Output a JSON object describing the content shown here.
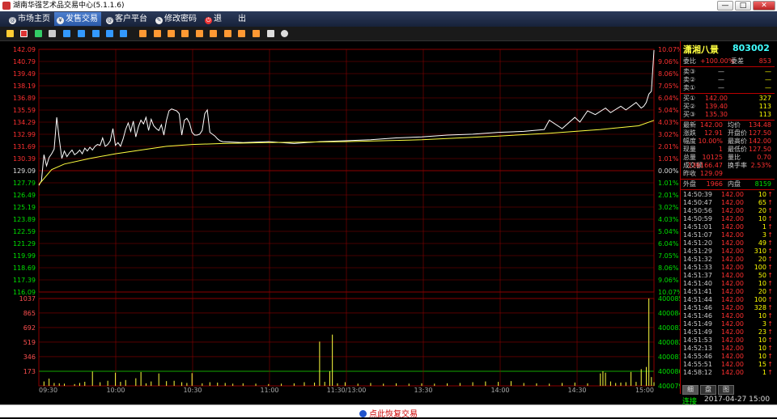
{
  "window": {
    "title": "湖南华强艺术品交易中心(5.1.1.6)",
    "min": "—",
    "max": "□",
    "close": "✕"
  },
  "menu": [
    {
      "label": "市场主页",
      "active": false
    },
    {
      "label": "发售交易",
      "active": true
    },
    {
      "label": "客户平台",
      "active": false
    },
    {
      "label": "修改密码",
      "active": false
    },
    {
      "label": "退　　出",
      "active": false
    }
  ],
  "quote": {
    "name": "潇湘八景",
    "code": "803002",
    "webi_label": "委比",
    "webi_value": "+100.00%",
    "weicha_label": "委差",
    "weicha_value": "853",
    "asks": [
      {
        "label": "卖③",
        "price": "—",
        "vol": "—"
      },
      {
        "label": "卖②",
        "price": "—",
        "vol": "—"
      },
      {
        "label": "卖①",
        "price": "—",
        "vol": "—"
      }
    ],
    "bids": [
      {
        "label": "买①",
        "price": "142.00",
        "vol": "327"
      },
      {
        "label": "买②",
        "price": "139.40",
        "vol": "113"
      },
      {
        "label": "买③",
        "price": "135.30",
        "vol": "113"
      }
    ],
    "stats": [
      {
        "l1": "最新",
        "v1": "142.00",
        "l2": "均价",
        "v2": "134.48"
      },
      {
        "l1": "涨跌",
        "v1": "12.91",
        "l2": "开盘价",
        "v2": "127.50"
      },
      {
        "l1": "幅度",
        "v1": "10.00%",
        "l2": "最高价",
        "v2": "142.00"
      },
      {
        "l1": "现量",
        "v1": "1",
        "l2": "最低价",
        "v2": "127.50"
      },
      {
        "l1": "总量",
        "v1": "10125",
        "l2": "量比",
        "v2": "0.70"
      },
      {
        "l1": "成交额",
        "v1": "136166.47",
        "l2": "换手率",
        "v2": "2.53%"
      },
      {
        "l1": "昨收",
        "v1": "129.09",
        "l2": "",
        "v2": ""
      }
    ],
    "waipan_label": "外盘",
    "waipan": "1966",
    "neipan_label": "内盘",
    "neipan": "8159"
  },
  "ticks": [
    {
      "t": "14:50:39",
      "p": "142.00",
      "v": "10"
    },
    {
      "t": "14:50:47",
      "p": "142.00",
      "v": "65"
    },
    {
      "t": "14:50:56",
      "p": "142.00",
      "v": "20"
    },
    {
      "t": "14:50:59",
      "p": "142.00",
      "v": "10"
    },
    {
      "t": "14:51:01",
      "p": "142.00",
      "v": "1"
    },
    {
      "t": "14:51:07",
      "p": "142.00",
      "v": "3"
    },
    {
      "t": "14:51:20",
      "p": "142.00",
      "v": "49"
    },
    {
      "t": "14:51:29",
      "p": "142.00",
      "v": "310"
    },
    {
      "t": "14:51:32",
      "p": "142.00",
      "v": "20"
    },
    {
      "t": "14:51:33",
      "p": "142.00",
      "v": "100"
    },
    {
      "t": "14:51:37",
      "p": "142.00",
      "v": "50"
    },
    {
      "t": "14:51:40",
      "p": "142.00",
      "v": "10"
    },
    {
      "t": "14:51:41",
      "p": "142.00",
      "v": "20"
    },
    {
      "t": "14:51:44",
      "p": "142.00",
      "v": "100"
    },
    {
      "t": "14:51:46",
      "p": "142.00",
      "v": "328"
    },
    {
      "t": "14:51:46",
      "p": "142.00",
      "v": "10"
    },
    {
      "t": "14:51:49",
      "p": "142.00",
      "v": "3"
    },
    {
      "t": "14:51:49",
      "p": "142.00",
      "v": "23"
    },
    {
      "t": "14:51:53",
      "p": "142.00",
      "v": "10"
    },
    {
      "t": "14:52:13",
      "p": "142.00",
      "v": "10"
    },
    {
      "t": "14:55:46",
      "p": "142.00",
      "v": "10"
    },
    {
      "t": "14:55:51",
      "p": "142.00",
      "v": "15"
    },
    {
      "t": "14:58:12",
      "p": "142.00",
      "v": "1"
    }
  ],
  "side_tabs": [
    "细",
    "盘",
    "图"
  ],
  "connection": "连接",
  "datetime": "2017-04-27 15:00",
  "restore_label": "点此恢复交易",
  "colors": {
    "up": "#ff3030",
    "down": "#00e000",
    "grid": "#8b0000",
    "price_line": "#ffffff",
    "avg_line": "#ffff40"
  },
  "chart_data": {
    "type": "line",
    "price_ticks": [
      "142.09",
      "140.79",
      "139.49",
      "138.19",
      "136.89",
      "135.59",
      "134.29",
      "132.99",
      "131.69",
      "130.39",
      "129.09",
      "127.79",
      "126.49",
      "125.19",
      "123.89",
      "122.59",
      "121.29",
      "119.99",
      "118.69",
      "117.39",
      "116.09"
    ],
    "pct_ticks": [
      "10.07%",
      "9.06%",
      "8.06%",
      "7.05%",
      "6.04%",
      "5.04%",
      "4.03%",
      "3.02%",
      "2.01%",
      "1.01%",
      "0.00%",
      "1.01%",
      "2.01%",
      "3.02%",
      "4.03%",
      "5.04%",
      "6.04%",
      "7.05%",
      "8.06%",
      "9.06%",
      "10.07%"
    ],
    "vol_ticks": [
      "1037",
      "865",
      "692",
      "519",
      "346",
      "173"
    ],
    "vol_right_ticks": [
      "400085",
      "400084",
      "400083",
      "400082",
      "400081",
      "400080",
      "400079"
    ],
    "time_labels": [
      "09:30",
      "10:00",
      "10:30",
      "11:00",
      "11:30/13:00",
      "13:30",
      "14:00",
      "14:30",
      "15:00"
    ],
    "ylim": [
      116.09,
      142.09
    ],
    "prev_close": 129.09,
    "vol_max": 1037,
    "price": [
      [
        0,
        127.5
      ],
      [
        1,
        128.0
      ],
      [
        2,
        130.8
      ],
      [
        3,
        129.6
      ],
      [
        4,
        130.5
      ],
      [
        5,
        130.9
      ],
      [
        6,
        131.4
      ],
      [
        7,
        134.8
      ],
      [
        8,
        132.5
      ],
      [
        9,
        130.4
      ],
      [
        10,
        131.2
      ],
      [
        11,
        130.6
      ],
      [
        12,
        131.0
      ],
      [
        13,
        131.3
      ],
      [
        14,
        130.8
      ],
      [
        15,
        131.0
      ],
      [
        16,
        131.3
      ],
      [
        17,
        130.9
      ],
      [
        18,
        131.5
      ],
      [
        19,
        131.2
      ],
      [
        20,
        131.6
      ],
      [
        21,
        131.3
      ],
      [
        22,
        131.7
      ],
      [
        23,
        131.9
      ],
      [
        24,
        131.8
      ],
      [
        25,
        132.6
      ],
      [
        26,
        131.7
      ],
      [
        27,
        131.9
      ],
      [
        28,
        132.3
      ],
      [
        29,
        133.6
      ],
      [
        30,
        131.8
      ],
      [
        31,
        132.1
      ],
      [
        32,
        131.7
      ],
      [
        33,
        132.5
      ],
      [
        34,
        133.5
      ],
      [
        35,
        134.2
      ],
      [
        36,
        133.3
      ],
      [
        37,
        134.4
      ],
      [
        38,
        132.7
      ],
      [
        39,
        133.8
      ],
      [
        40,
        134.5
      ],
      [
        41,
        134.1
      ],
      [
        42,
        134.8
      ],
      [
        43,
        133.4
      ],
      [
        44,
        134.6
      ],
      [
        45,
        133.9
      ],
      [
        46,
        133.6
      ],
      [
        47,
        133.4
      ],
      [
        48,
        134.0
      ],
      [
        49,
        132.9
      ],
      [
        50,
        134.5
      ],
      [
        51,
        135.5
      ],
      [
        52,
        135.7
      ],
      [
        53,
        135.6
      ],
      [
        54,
        135.5
      ],
      [
        55,
        135.2
      ],
      [
        56,
        132.9
      ],
      [
        57,
        134.5
      ],
      [
        58,
        134.7
      ],
      [
        59,
        134.2
      ],
      [
        60,
        133.2
      ],
      [
        61,
        132.9
      ],
      [
        62,
        132.9
      ],
      [
        63,
        133.0
      ],
      [
        64,
        133.4
      ],
      [
        65,
        135.2
      ],
      [
        66,
        135.6
      ],
      [
        67,
        133.2
      ],
      [
        68,
        133.0
      ],
      [
        69,
        132.8
      ],
      [
        70,
        132.5
      ],
      [
        71,
        132.3
      ],
      [
        72,
        132.2
      ],
      [
        80,
        132.1
      ],
      [
        90,
        132.2
      ],
      [
        100,
        132.0
      ],
      [
        110,
        132.2
      ],
      [
        120,
        132.3
      ],
      [
        130,
        132.4
      ],
      [
        140,
        132.6
      ],
      [
        150,
        132.7
      ],
      [
        160,
        132.9
      ],
      [
        170,
        133.0
      ],
      [
        180,
        133.2
      ],
      [
        190,
        133.3
      ],
      [
        198,
        133.5
      ],
      [
        200,
        134.5
      ],
      [
        205,
        133.6
      ],
      [
        210,
        134.8
      ],
      [
        212,
        134.3
      ],
      [
        215,
        135.5
      ],
      [
        218,
        135.1
      ],
      [
        222,
        135.8
      ],
      [
        224,
        135.3
      ],
      [
        228,
        136.0
      ],
      [
        230,
        135.6
      ],
      [
        234,
        136.4
      ],
      [
        236,
        135.8
      ],
      [
        237,
        136.0
      ],
      [
        238,
        136.4
      ],
      [
        239,
        137.3
      ],
      [
        240,
        137.6
      ],
      [
        241,
        142.0
      ]
    ],
    "avg": [
      [
        0,
        127.6
      ],
      [
        5,
        129.2
      ],
      [
        10,
        129.8
      ],
      [
        20,
        130.4
      ],
      [
        30,
        130.9
      ],
      [
        40,
        131.3
      ],
      [
        50,
        131.7
      ],
      [
        60,
        131.9
      ],
      [
        72,
        132.0
      ],
      [
        90,
        132.1
      ],
      [
        120,
        132.2
      ],
      [
        150,
        132.4
      ],
      [
        180,
        132.8
      ],
      [
        200,
        133.1
      ],
      [
        220,
        133.5
      ],
      [
        235,
        133.9
      ],
      [
        241,
        134.48
      ]
    ],
    "volume": [
      [
        2,
        52
      ],
      [
        4,
        86
      ],
      [
        6,
        34
      ],
      [
        8,
        30
      ],
      [
        10,
        26
      ],
      [
        14,
        21
      ],
      [
        16,
        34
      ],
      [
        18,
        48
      ],
      [
        21,
        169
      ],
      [
        24,
        43
      ],
      [
        27,
        60
      ],
      [
        30,
        156
      ],
      [
        32,
        47
      ],
      [
        34,
        69
      ],
      [
        38,
        90
      ],
      [
        40,
        164
      ],
      [
        42,
        30
      ],
      [
        44,
        52
      ],
      [
        47,
        147
      ],
      [
        50,
        56
      ],
      [
        53,
        60
      ],
      [
        56,
        43
      ],
      [
        58,
        34
      ],
      [
        60,
        151
      ],
      [
        64,
        30
      ],
      [
        67,
        43
      ],
      [
        70,
        38
      ],
      [
        73,
        34
      ],
      [
        76,
        26
      ],
      [
        80,
        30
      ],
      [
        85,
        26
      ],
      [
        90,
        21
      ],
      [
        95,
        26
      ],
      [
        100,
        30
      ],
      [
        104,
        43
      ],
      [
        108,
        39
      ],
      [
        110,
        525
      ],
      [
        112,
        47
      ],
      [
        114,
        173
      ],
      [
        115,
        608
      ],
      [
        117,
        30
      ],
      [
        120,
        43
      ],
      [
        125,
        26
      ],
      [
        130,
        34
      ],
      [
        135,
        26
      ],
      [
        140,
        30
      ],
      [
        145,
        26
      ],
      [
        150,
        30
      ],
      [
        155,
        26
      ],
      [
        160,
        30
      ],
      [
        165,
        34
      ],
      [
        170,
        43
      ],
      [
        175,
        52
      ],
      [
        180,
        47
      ],
      [
        185,
        56
      ],
      [
        190,
        34
      ],
      [
        195,
        30
      ],
      [
        200,
        26
      ],
      [
        205,
        34
      ],
      [
        210,
        39
      ],
      [
        215,
        30
      ],
      [
        220,
        147
      ],
      [
        221,
        173
      ],
      [
        222,
        156
      ],
      [
        224,
        52
      ],
      [
        226,
        34
      ],
      [
        228,
        39
      ],
      [
        230,
        43
      ],
      [
        232,
        165
      ],
      [
        234,
        47
      ],
      [
        236,
        198
      ],
      [
        238,
        224
      ],
      [
        239,
        1037
      ],
      [
        240,
        104
      ],
      [
        241,
        43
      ]
    ]
  }
}
